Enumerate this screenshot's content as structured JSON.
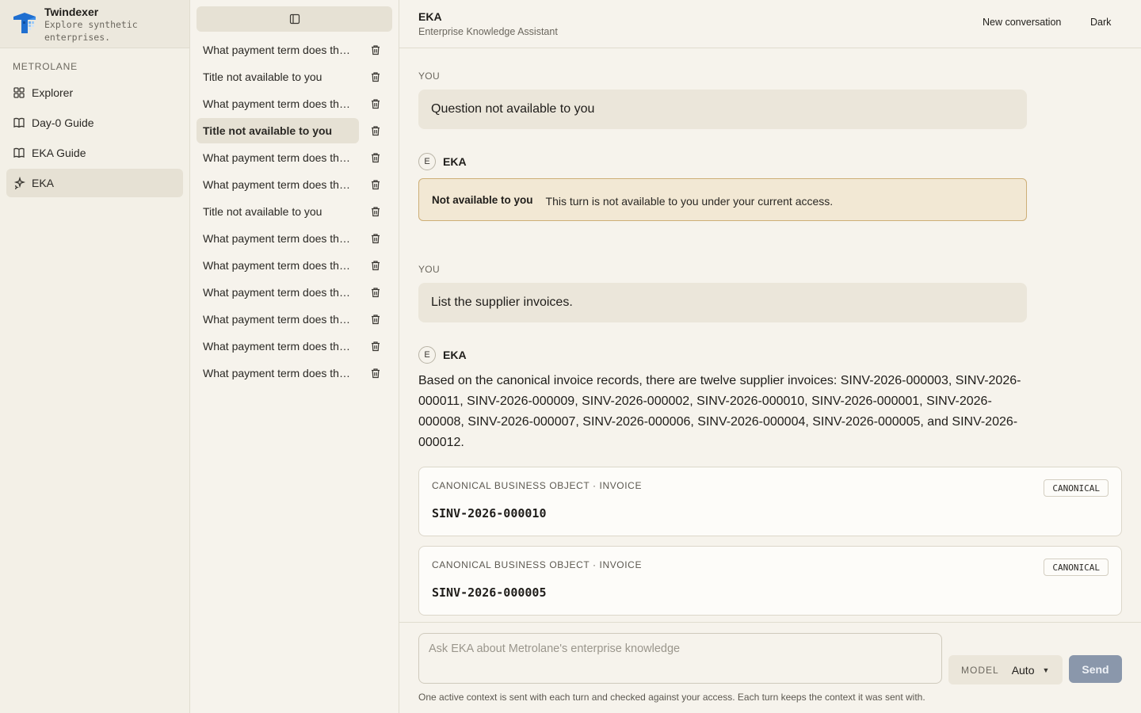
{
  "brand": {
    "name": "Twindexer",
    "tagline": "Explore synthetic enterprises."
  },
  "sidebar": {
    "org_label": "METROLANE",
    "items": [
      {
        "label": "Explorer",
        "icon": "grid-icon"
      },
      {
        "label": "Day-0 Guide",
        "icon": "book-icon"
      },
      {
        "label": "EKA Guide",
        "icon": "book-icon"
      },
      {
        "label": "EKA",
        "icon": "sparkle-icon",
        "active": true
      }
    ]
  },
  "conversations": [
    "What payment term does the supplier use?",
    "Title not available to you",
    "What payment term does the supplier use?",
    "Title not available to you",
    "What payment term does the supplier use?",
    "What payment term does the supplier use?",
    "Title not available to you",
    "What payment term does the supplier use?",
    "What payment term does the supplier use?",
    "What payment term does the supplier use?",
    "What payment term does the supplier use?",
    "What payment term does the supplier use?",
    "What payment term does the supplier use?"
  ],
  "header": {
    "title": "EKA",
    "subtitle": "Enterprise Knowledge Assistant",
    "new_conversation": "New conversation",
    "theme": "Dark"
  },
  "thread": {
    "you_label": "YOU",
    "eka_label": "EKA",
    "avatar_letter": "E",
    "turn1_question": "Question not available to you",
    "restricted_title": "Not available to you",
    "restricted_text": "This turn is not available to you under your current access.",
    "turn2_question": "List the supplier invoices.",
    "turn2_answer": "Based on the canonical invoice records, there are twelve supplier invoices: SINV-2026-000003, SINV-2026-000011, SINV-2026-000009, SINV-2026-000002, SINV-2026-000010, SINV-2026-000001, SINV-2026-000008, SINV-2026-000007, SINV-2026-000006, SINV-2026-000004, SINV-2026-000005, and SINV-2026-000012.",
    "cards": [
      {
        "kicker": "CANONICAL BUSINESS OBJECT · INVOICE",
        "id": "SINV-2026-000010",
        "badge": "CANONICAL"
      },
      {
        "kicker": "CANONICAL BUSINESS OBJECT · INVOICE",
        "id": "SINV-2026-000005",
        "badge": "CANONICAL"
      }
    ]
  },
  "composer": {
    "placeholder": "Ask EKA about Metrolane's enterprise knowledge",
    "model_label": "MODEL",
    "model_value": "Auto",
    "send_label": "Send",
    "footnote": "One active context is sent with each turn and checked against your access. Each turn keeps the context it was sent with."
  }
}
